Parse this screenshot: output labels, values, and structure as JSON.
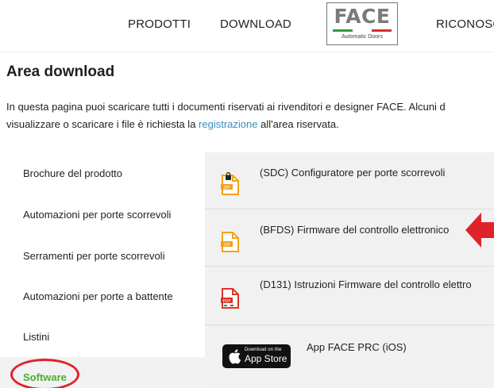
{
  "header": {
    "nav": [
      "PRODOTTI",
      "DOWNLOAD",
      "RICONOSC"
    ],
    "logo": {
      "word": "FACE",
      "subtitle": "Automatic Doors",
      "flag_colors": [
        "#2e9a3e",
        "#ffffff",
        "#d32f2f"
      ]
    }
  },
  "page": {
    "title": "Area download",
    "intro_line1": "In questa pagina puoi scaricare tutti i documenti riservati ai rivenditori e designer FACE. Alcuni d",
    "intro_line2_before": "visualizzare o scaricare i file è richiesta la ",
    "intro_link": "registrazione",
    "intro_line2_after": " all'area riservata."
  },
  "sidebar": {
    "items": [
      "Brochure del prodotto",
      "Automazioni per porte scorrevoli",
      "Serramenti per porte scorrevoli",
      "Automazioni per porte a battente",
      "Listini"
    ],
    "active_item": "Software",
    "active_color": "#4caf2e"
  },
  "files": [
    {
      "label": "(SDC) Configuratore per porte scorrevoli",
      "icon": "zip-locked-file-icon"
    },
    {
      "label": "(BFDS) Firmware del controllo elettronico",
      "icon": "zip-file-icon"
    },
    {
      "label": "(D131) Istruzioni Firmware del controllo elettro",
      "icon": "pdf-file-icon"
    },
    {
      "label": "App FACE PRC (iOS)",
      "icon": "app-store-badge"
    }
  ],
  "appstore_badge": {
    "small": "Download on the",
    "big": "App Store"
  },
  "colors": {
    "accent_green": "#4caf2e",
    "link_blue": "#3a8fbf",
    "annotation_red": "#e0232b",
    "file_orange": "#f2a21c",
    "pdf_red": "#d9362b"
  }
}
